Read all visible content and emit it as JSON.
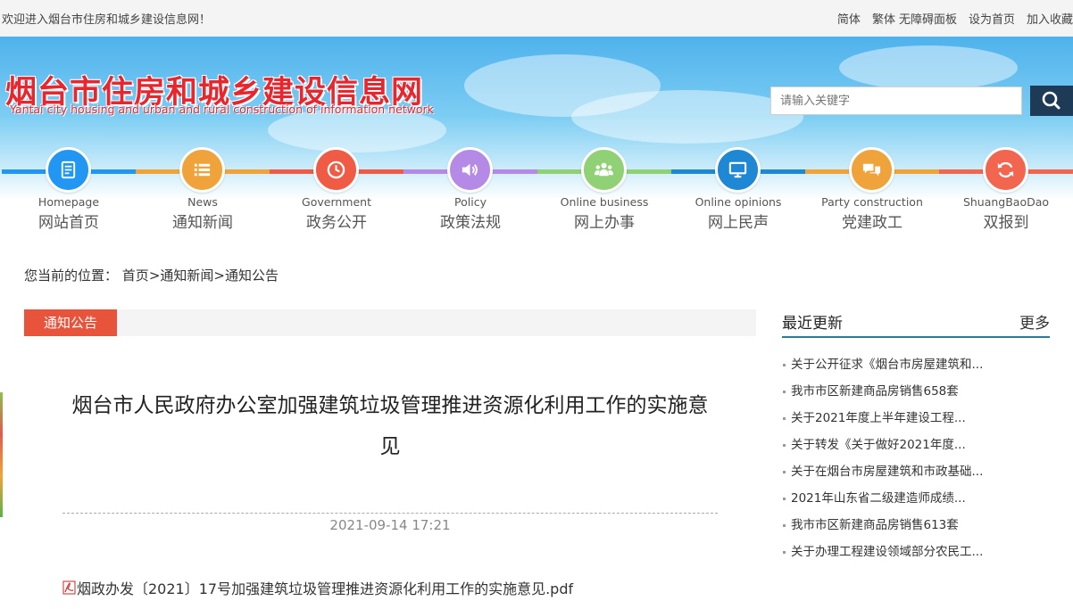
{
  "topbar": {
    "welcome": "欢迎进入烟台市住房和城乡建设信息网！",
    "links": [
      "简体",
      "繁体",
      "无障碍面板",
      "设为首页",
      "加入收藏"
    ]
  },
  "header": {
    "site_title": "烟台市住房和城乡建设信息网",
    "site_subtitle": "Yantai city housing and urban and rural construction of information network",
    "search_placeholder": "请输入关键字"
  },
  "nav": [
    {
      "en": "Homepage",
      "zh": "网站首页",
      "color": "#2196f3",
      "bar": "#2196f3",
      "icon": "document-icon"
    },
    {
      "en": "News",
      "zh": "通知新闻",
      "color": "#f0a33a",
      "bar": "#f0a33a",
      "icon": "list-icon"
    },
    {
      "en": "Government",
      "zh": "政务公开",
      "color": "#ef5b45",
      "bar": "#ef5b45",
      "icon": "clock-icon"
    },
    {
      "en": "Policy",
      "zh": "政策法规",
      "color": "#b48ae6",
      "bar": "#b48ae6",
      "icon": "speaker-icon"
    },
    {
      "en": "Online business",
      "zh": "网上办事",
      "color": "#8fd174",
      "bar": "#8fd174",
      "icon": "people-icon"
    },
    {
      "en": "Online opinions",
      "zh": "网上民声",
      "color": "#1e88d4",
      "bar": "#1e88d4",
      "icon": "monitor-icon"
    },
    {
      "en": "Party construction",
      "zh": "党建政工",
      "color": "#f0a33a",
      "bar": "#f0a33a",
      "icon": "chat-icon"
    },
    {
      "en": "ShuangBaoDao",
      "zh": "双报到",
      "color": "#f2654f",
      "bar": "#f2654f",
      "icon": "refresh-icon"
    }
  ],
  "breadcrumb": {
    "prefix": "您当前的位置：",
    "items": [
      "首页",
      "通知新闻",
      "通知公告"
    ],
    "separator": ">"
  },
  "section": {
    "tab_label": "通知公告"
  },
  "article": {
    "title": "烟台市人民政府办公室加强建筑垃圾管理推进资源化利用工作的实施意见",
    "date": "2021-09-14 17:21",
    "attachment": "烟政办发〔2021〕17号加强建筑垃圾管理推进资源化利用工作的实施意见.pdf"
  },
  "sidebar": {
    "title": "最近更新",
    "more": "更多",
    "items": [
      "关于公开征求《烟台市房屋建筑和...",
      "我市市区新建商品房销售658套",
      "关于2021年度上半年建设工程...",
      "关于转发《关于做好2021年度...",
      "关于在烟台市房屋建筑和市政基础...",
      "2021年山东省二级建造师成绩...",
      "我市市区新建商品房销售613套",
      "关于办理工程建设领域部分农民工..."
    ]
  }
}
